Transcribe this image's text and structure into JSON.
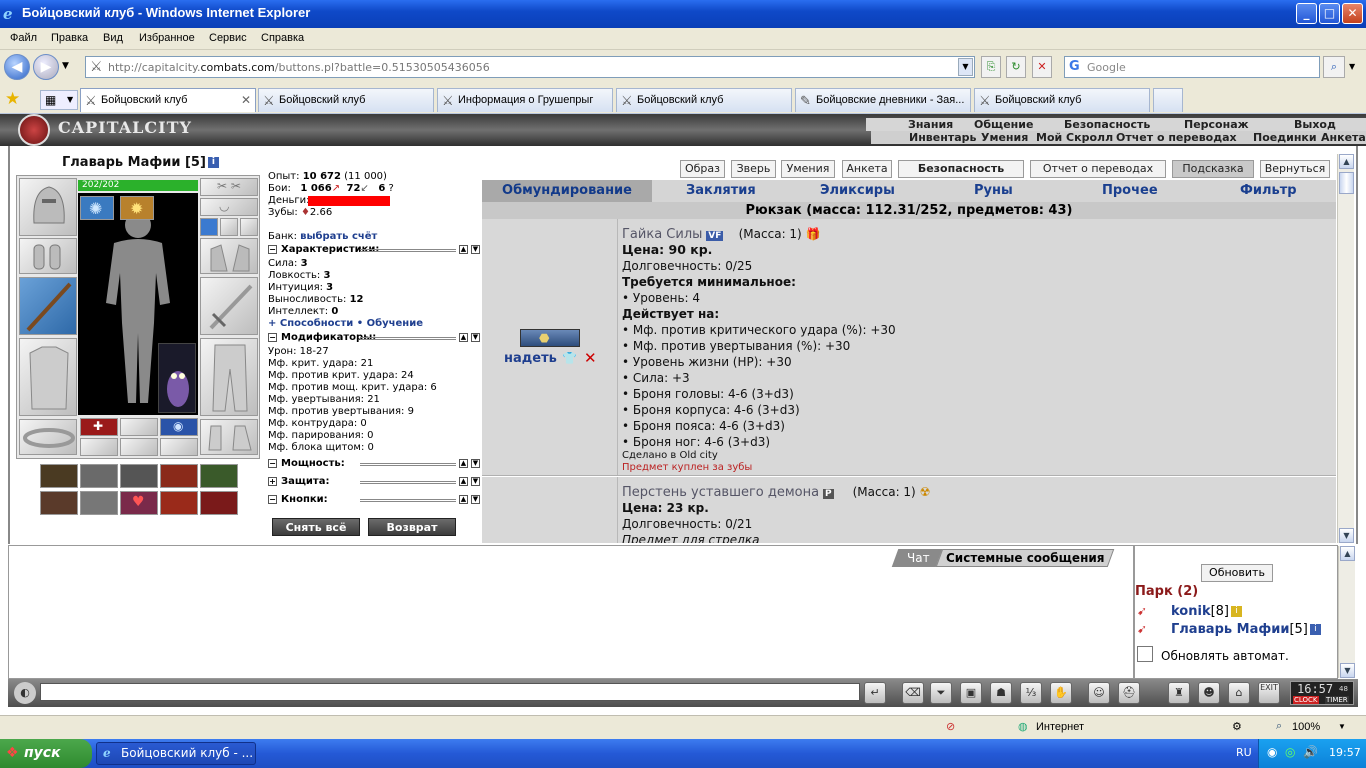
{
  "window": {
    "title": "Бойцовский клуб - Windows Internet Explorer",
    "minimize": "_",
    "maximize": "□",
    "close": "✕"
  },
  "menu": [
    "Файл",
    "Правка",
    "Вид",
    "Избранное",
    "Сервис",
    "Справка"
  ],
  "address": {
    "url_prefix": "http://capitalcity.",
    "url_domain": "combats.com",
    "url_suffix": "/buttons.pl?battle=0.51530505436056",
    "search_placeholder": "Google"
  },
  "tabs": [
    "Бойцовский клуб",
    "Бойцовский клуб",
    "Информация о Грушепрыг",
    "Бойцовский клуб",
    "Бойцовские дневники - Зая...",
    "Бойцовский клуб"
  ],
  "game": {
    "city": "CAPITALCITY",
    "toplinks_row1": [
      "Знания",
      "Общение",
      "Безопасность",
      "Персонаж",
      "Выход"
    ],
    "toplinks_row2": [
      "Инвентарь",
      "Умения",
      "Мой Скролл",
      "Отчет о переводах",
      "Поединки",
      "Анкета"
    ],
    "buttons": [
      "Образ",
      "Зверь",
      "Умения",
      "Анкета",
      "Безопасность",
      "Отчет о переводах",
      "Подсказка",
      "Вернуться"
    ]
  },
  "character": {
    "name": "Главарь Мафии [5]",
    "hp": "202/202",
    "experience_label": "Опыт:",
    "experience": "10 672",
    "experience_next": "(11 000)",
    "fights_label": "Бои:",
    "wins": "1 066",
    "losses": "72",
    "draws": "6",
    "money_label": "Деньги:",
    "teeth_label": "Зубы:",
    "teeth": "2.66",
    "bank_label": "Банк:",
    "bank_link": "выбрать счёт",
    "chars_header": "Характеристики:",
    "stats": [
      {
        "label": "Сила:",
        "value": "3"
      },
      {
        "label": "Ловкость:",
        "value": "3"
      },
      {
        "label": "Интуиция:",
        "value": "3"
      },
      {
        "label": "Выносливость:",
        "value": "12"
      },
      {
        "label": "Интеллект:",
        "value": "0"
      }
    ],
    "abilities_link": "+ Способности",
    "training_link": "• Обучение",
    "modifiers_header": "Модификаторы:",
    "modifiers": [
      "Урон: 18-27",
      "Мф. крит. удара: 21",
      "Мф. против крит. удара: 24",
      "Мф. против мощ. крит. удара: 6",
      "Мф. увертывания: 21",
      "Мф. против увертывания: 9",
      "Мф. контрудара: 0",
      "Мф. парирования: 0",
      "Мф. блока щитом: 0"
    ],
    "power_header": "Мощность:",
    "defense_header": "Защита:",
    "buttons_header": "Кнопки:",
    "remove_all": "Снять всё",
    "return": "Возврат"
  },
  "inventory": {
    "tabs": [
      "Обмундирование",
      "Заклятия",
      "Эликсиры",
      "Руны",
      "Прочее",
      "Фильтр"
    ],
    "backpack": "Рюкзак (масса: 112.31/252, предметов: 43)",
    "item1": {
      "name": "Гайка Силы",
      "badge": "VF",
      "mass": "(Масса: 1)",
      "price": "Цена: 90 кр.",
      "durability": "Долговечность: 0/25",
      "req_header": "Требуется минимальное:",
      "requirements": [
        "• Уровень: 4"
      ],
      "effects_header": "Действует на:",
      "effects": [
        "• Мф. против критического удара (%): +30",
        "• Мф. против увертывания (%): +30",
        "• Уровень жизни (HP): +30",
        "• Сила: +3",
        "• Броня головы: 4-6 (3+d3)",
        "• Броня корпуса: 4-6 (3+d3)",
        "• Броня пояса: 4-6 (3+d3)",
        "• Броня ног: 4-6 (3+d3)"
      ],
      "made_in": "Сделано в Old city",
      "bought_note": "Предмет куплен за зубы",
      "equip_link": "надеть"
    },
    "item2": {
      "name": "Перстень уставшего демона",
      "badge": "P",
      "mass": "(Масса: 1)",
      "price": "Цена: 23 кр.",
      "durability": "Долговечность: 0/21",
      "note": "Предмет для стрелка"
    }
  },
  "chat": {
    "tab_chat": "Чат",
    "tab_system": "Системные сообщения"
  },
  "online": {
    "refresh": "Обновить",
    "location": "Парк (2)",
    "users": [
      {
        "name": "konik",
        "level": "[8]"
      },
      {
        "name": "Главарь Мафии",
        "level": "[5]"
      }
    ],
    "auto_refresh": "Обновлять автомат."
  },
  "clock": {
    "time": "16:57",
    "seconds": "48",
    "clock_label": "CLOCK",
    "timer_label": "TIMER",
    "exit_label": "EXIT"
  },
  "status": {
    "zone": "Интернет",
    "zoom": "100%"
  },
  "taskbar": {
    "start": "пуск",
    "task": "Бойцовский клуб - ...",
    "lang": "RU",
    "time": "19:57"
  }
}
